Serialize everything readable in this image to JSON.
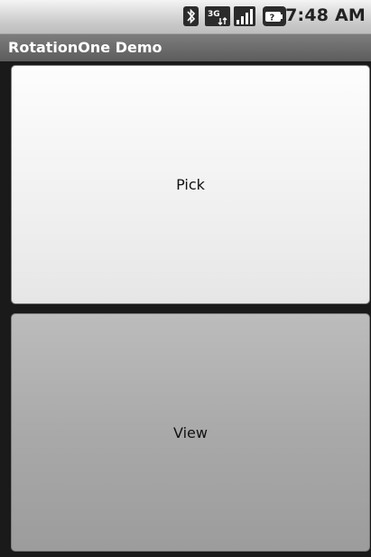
{
  "status_bar": {
    "time": "7:48 AM",
    "icons": [
      "bluetooth-icon",
      "3g-icon",
      "signal-icon",
      "battery-unknown-icon"
    ]
  },
  "app": {
    "title": "RotationOne Demo"
  },
  "buttons": {
    "pick_label": "Pick",
    "view_label": "View"
  },
  "colors": {
    "title_bar": "#6b6b6b",
    "background": "#1a1a1a",
    "pick_button": "#f2f2f2",
    "view_button": "#a8a8a8"
  }
}
